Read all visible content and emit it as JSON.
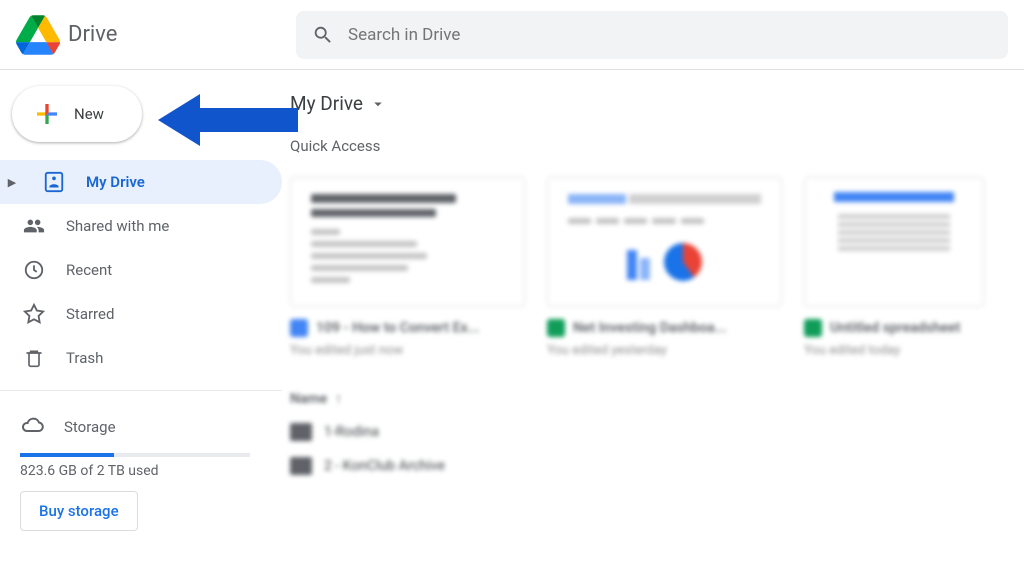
{
  "app": {
    "name": "Drive"
  },
  "search": {
    "placeholder": "Search in Drive"
  },
  "new_button": {
    "label": "New"
  },
  "sidebar": {
    "items": [
      {
        "label": "My Drive"
      },
      {
        "label": "Shared with me"
      },
      {
        "label": "Recent"
      },
      {
        "label": "Starred"
      },
      {
        "label": "Trash"
      }
    ],
    "storage_label": "Storage",
    "storage_used": "823.6 GB of 2 TB used",
    "storage_percent": 41,
    "buy_label": "Buy storage"
  },
  "breadcrumb": {
    "current": "My Drive"
  },
  "quick_access": {
    "title": "Quick Access",
    "cards": [
      {
        "title": "109 - How to Convert Ex...",
        "subtitle": "You edited just now",
        "type": "doc"
      },
      {
        "title": "Net Investing Dashboa...",
        "subtitle": "You edited yesterday",
        "type": "sheet"
      },
      {
        "title": "Untitled spreadsheet",
        "subtitle": "You edited today",
        "type": "sheet"
      }
    ]
  },
  "listing": {
    "name_header": "Name",
    "rows": [
      {
        "name": "1-Rodina"
      },
      {
        "name": "2 - KonClub Archive"
      }
    ]
  },
  "annotation": {
    "arrow_color": "#1155cc"
  }
}
